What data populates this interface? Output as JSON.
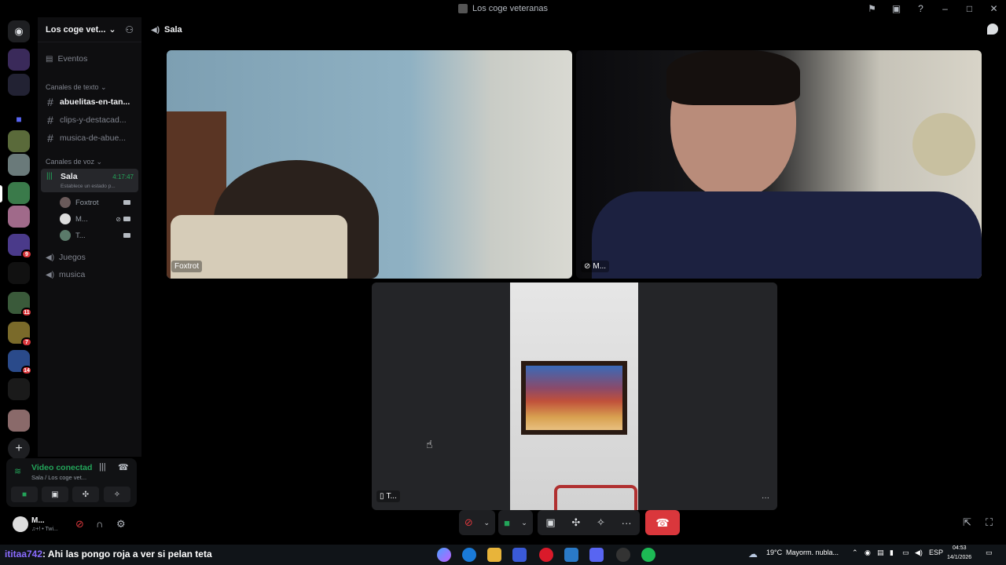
{
  "window": {
    "title": "Los coge veteranas",
    "controls": [
      "inbox-icon",
      "monitor-icon",
      "help-icon",
      "minimize",
      "maximize",
      "close"
    ]
  },
  "server": {
    "name": "Los coge vet...",
    "events_label": "Eventos",
    "text_category": "Canales de texto",
    "text_channels": [
      "abuelitas-en-tan...",
      "clips-y-destacad...",
      "musica-de-abue..."
    ],
    "voice_category": "Canales de voz",
    "voice_channel": {
      "name": "Sala",
      "time": "4:17:47",
      "status_placeholder": "Establece un estado p...",
      "users": [
        {
          "name": "Foxtrot"
        },
        {
          "name": "M..."
        },
        {
          "name": "T..."
        }
      ]
    },
    "other_voice_channels": [
      "Juegos",
      "musica"
    ]
  },
  "rail_badges": [
    "9",
    "11",
    "7",
    "14"
  ],
  "voice_panel": {
    "title": "Video conectad",
    "subtitle": "Sala / Los coge vet..."
  },
  "user_panel": {
    "name": "M...",
    "status": "♫+! • Twi..."
  },
  "main": {
    "channel_name": "Sala",
    "tiles": [
      {
        "name": "Foxtrot"
      },
      {
        "name": "M..."
      },
      {
        "name": "T..."
      }
    ],
    "tile_more": "···"
  },
  "taskbar": {
    "chat_nick": "ititaa742",
    "chat_message": ": Ahi las pongo roja a ver si pelan teta",
    "weather_temp": "19°C",
    "weather_desc": "Mayorm. nubla...",
    "lang": "ESP",
    "time": "04:53",
    "date": "14/1/2026"
  },
  "colors": {
    "accent_green": "#23a55a",
    "hangup_red": "#da373c",
    "badge_red": "#da373c",
    "blurple": "#5865f2"
  }
}
